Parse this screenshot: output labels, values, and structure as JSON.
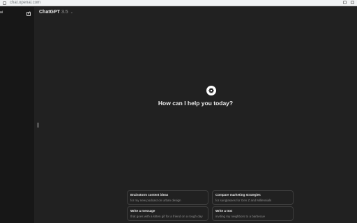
{
  "browser": {
    "url": "chat.openai.com"
  },
  "sidebar": {
    "glyph": "ai"
  },
  "header": {
    "model_name": "ChatGPT",
    "model_version": "3.5",
    "chevron": "⌄"
  },
  "main": {
    "greeting": "How can I help you today?"
  },
  "suggestions": [
    {
      "title": "Brainstorm content ideas",
      "subtitle": "for my new podcast on urban design"
    },
    {
      "title": "Compare marketing strategies",
      "subtitle": "for sunglasses for Gen Z and Millennials"
    },
    {
      "title": "Write a message",
      "subtitle": "that goes with a kitten gif for a friend on a rough day"
    },
    {
      "title": "Write a text",
      "subtitle": "inviting my neighbors to a barbecue"
    }
  ],
  "colors": {
    "background": "#212121",
    "sidebar": "#171717",
    "text": "#ececec",
    "muted": "#8e8e8e"
  },
  "icons": [
    "lock-icon",
    "new-chat-icon",
    "chevron-down-icon",
    "openai-logo-icon"
  ]
}
